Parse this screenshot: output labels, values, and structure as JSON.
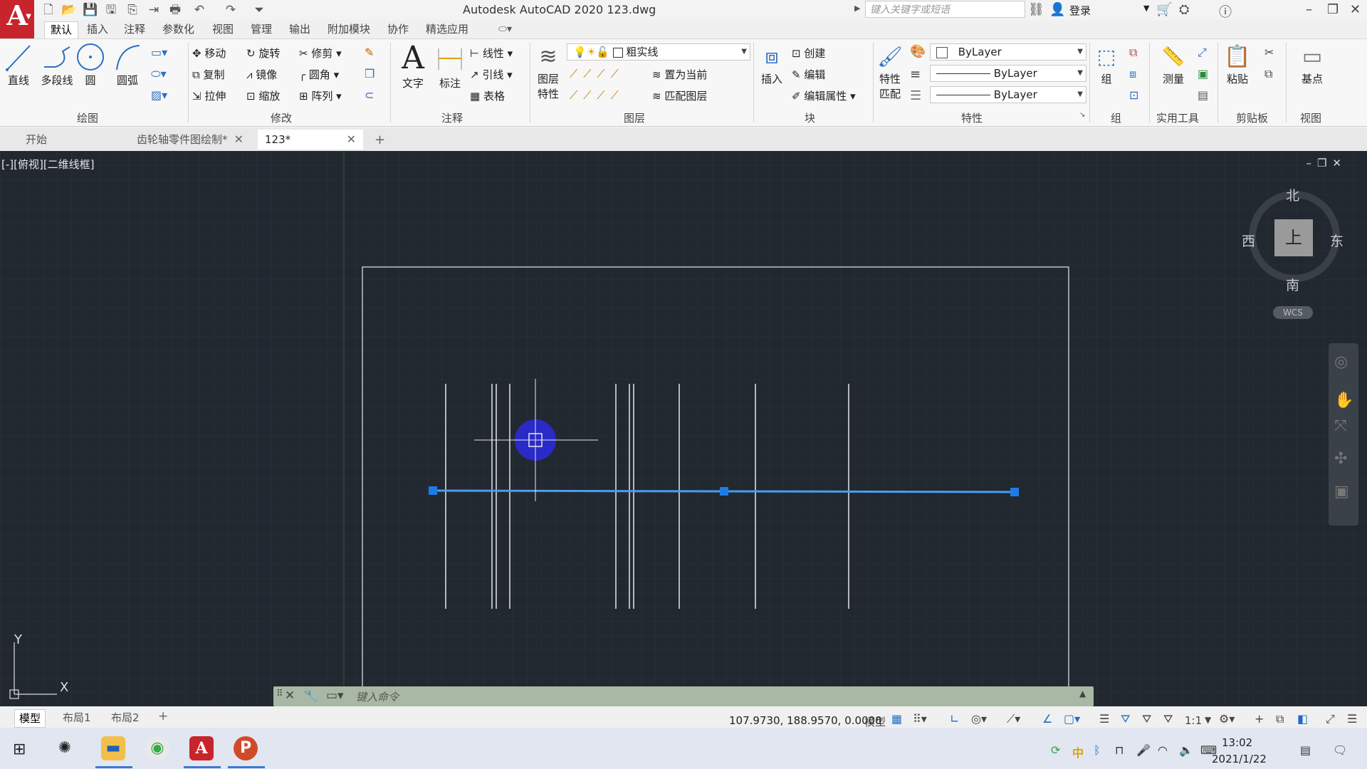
{
  "app": {
    "logo_letter": "A",
    "title": "Autodesk AutoCAD 2020    123.dwg",
    "search_placeholder": "键入关键字或短语",
    "login_label": "登录"
  },
  "ribbon_tabs": [
    "默认",
    "插入",
    "注释",
    "参数化",
    "视图",
    "管理",
    "输出",
    "附加模块",
    "协作",
    "精选应用"
  ],
  "ribbon": {
    "draw": {
      "line": "直线",
      "polyline": "多段线",
      "circle": "圆",
      "arc": "圆弧",
      "label": "绘图"
    },
    "modify": {
      "move": "移动",
      "rotate": "旋转",
      "trim": "修剪",
      "copy": "复制",
      "mirror": "镜像",
      "fillet": "圆角",
      "stretch": "拉伸",
      "scale": "缩放",
      "array": "阵列",
      "label": "修改"
    },
    "annotation": {
      "text": "文字",
      "dimension": "标注",
      "linear": "线性",
      "leader": "引线",
      "table": "表格",
      "label": "注释"
    },
    "layers": {
      "layer_props_line1": "图层",
      "layer_props_line2": "特性",
      "current_layer": "粗实线",
      "set_current": "置为当前",
      "match_layer": "匹配图层",
      "label": "图层"
    },
    "block": {
      "insert": "插入",
      "create": "创建",
      "edit": "编辑",
      "edit_attr": "编辑属性",
      "label": "块"
    },
    "properties": {
      "match_line1": "特性",
      "match_line2": "匹配",
      "color": "ByLayer",
      "lineweight": "ByLayer",
      "linetype": "ByLayer",
      "label": "特性"
    },
    "groups": {
      "group": "组",
      "label": "组"
    },
    "utilities": {
      "measure": "测量",
      "label": "实用工具"
    },
    "clipboard": {
      "paste": "粘贴",
      "label": "剪贴板"
    },
    "view": {
      "base": "基点",
      "label": "视图"
    }
  },
  "doc_tabs": [
    {
      "label": "开始",
      "closable": false,
      "active": false
    },
    {
      "label": "齿轮轴零件图绘制*",
      "closable": true,
      "active": false
    },
    {
      "label": "123*",
      "closable": true,
      "active": true
    }
  ],
  "viewport": {
    "label": "[-][俯视][二维线框]",
    "viewcube": {
      "face": "上",
      "north": "北",
      "south": "南",
      "east": "东",
      "west": "西",
      "wcs": "WCS"
    },
    "ucs": {
      "x": "X",
      "y": "Y"
    }
  },
  "command_line": {
    "placeholder": "键入命令"
  },
  "layout_tabs": [
    "模型",
    "布局1",
    "布局2"
  ],
  "status_bar": {
    "coordinates": "107.9730, 188.9570, 0.0000",
    "model": "模型",
    "scale": "1:1"
  },
  "taskbar": {
    "time": "13:02",
    "date": "2021/1/22",
    "ime": "中"
  },
  "colors": {
    "canvas": "#212830",
    "selected_line": "#4a9cf0",
    "grip": "#1e7be6",
    "autocad_red": "#c8242b"
  }
}
